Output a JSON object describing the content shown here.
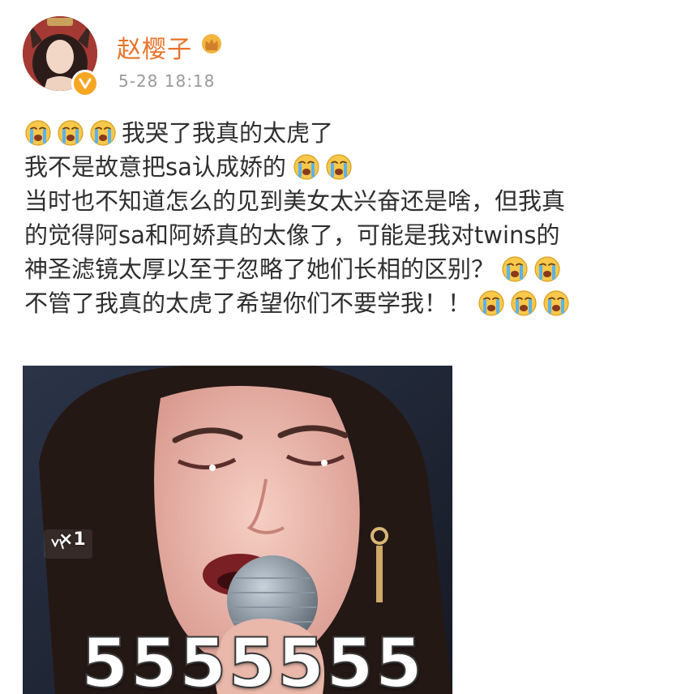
{
  "author": {
    "name": "赵樱子",
    "timestamp": "5-28 18:18"
  },
  "icons": {
    "avatar": "avatar-photo",
    "badge": "verified-badge-icon",
    "crown": "crown-icon",
    "emoji": "crying-face-icon"
  },
  "colors": {
    "author_name": "#e8732a",
    "badge": "#f7a623",
    "text": "#2f2f2f",
    "timestamp": "#9a9a9a"
  },
  "post": {
    "lines": [
      {
        "prefix_emojis": 3,
        "text": "我哭了我真的太虎了",
        "suffix_emojis": 0
      },
      {
        "prefix_emojis": 0,
        "text": "我不是故意把sa认成娇的",
        "suffix_emojis": 2
      },
      {
        "prefix_emojis": 0,
        "text": "当时也不知道怎么的见到美女太兴奋还是啥，但我真",
        "suffix_emojis": 0
      },
      {
        "prefix_emojis": 0,
        "text": "的觉得阿sa和阿娇真的太像了，可能是我对twins的",
        "suffix_emojis": 0
      },
      {
        "prefix_emojis": 0,
        "text": "神圣滤镜太厚以至于忽略了她们长相的区别？",
        "suffix_emojis": 2
      },
      {
        "prefix_emojis": 0,
        "text": "不管了我真的太虎了希望你们不要学我！！",
        "suffix_emojis": 3
      }
    ]
  },
  "image": {
    "overlay_badge": "×1",
    "caption": "5555555"
  }
}
